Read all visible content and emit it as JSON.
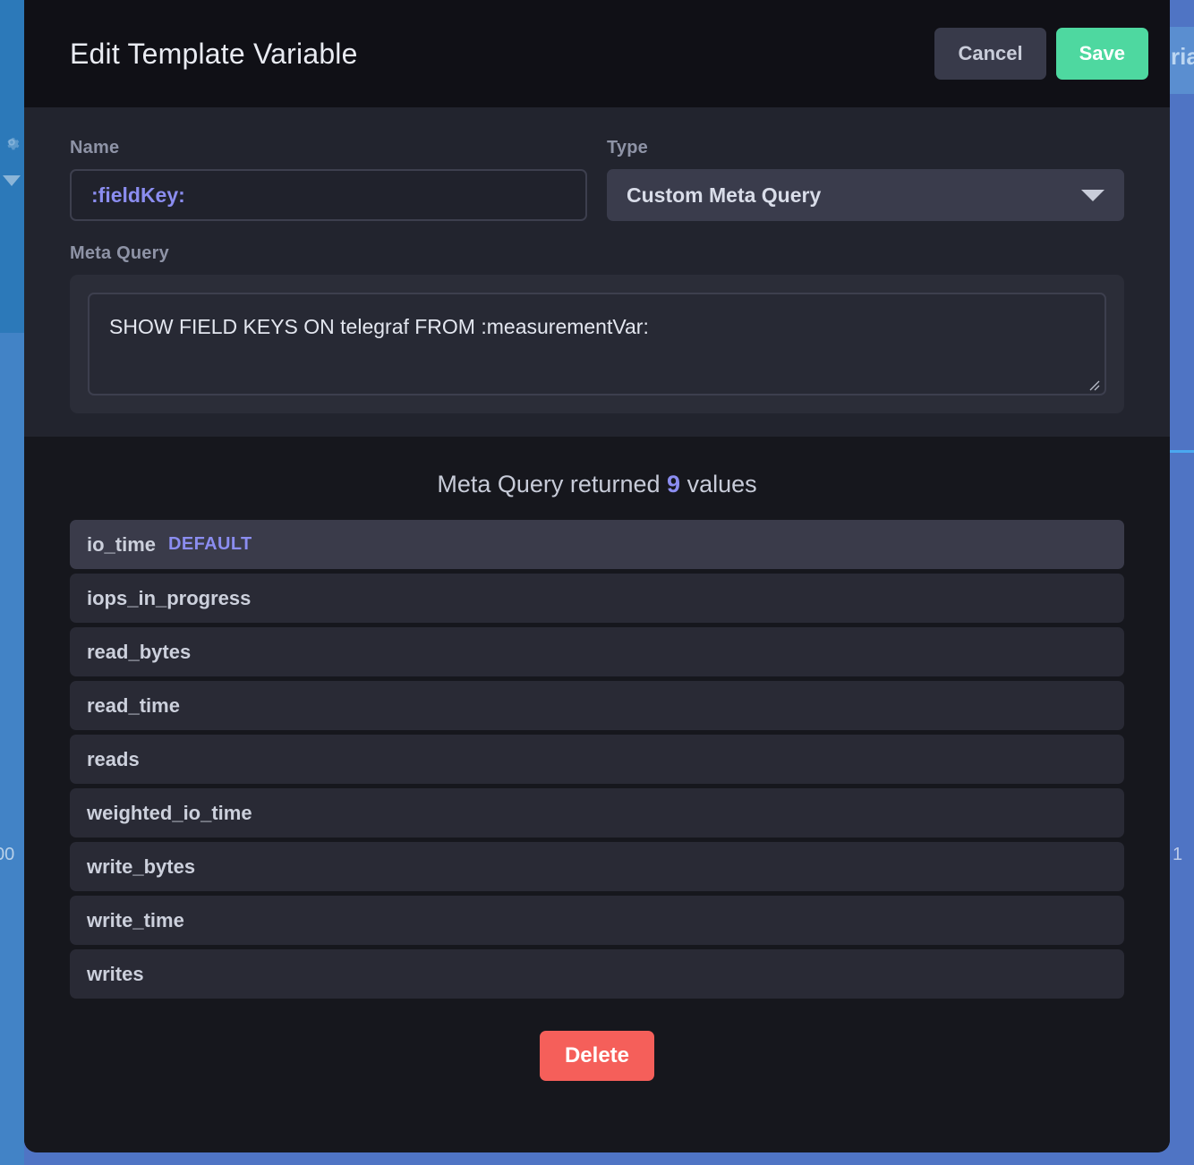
{
  "background": {
    "sidebar_gear_icon": "gear-icon",
    "sidebar_caret_icon": "caret-down-icon",
    "left_axis_label": "00",
    "right_panel_text": "ria",
    "right_axis_label": "1"
  },
  "header": {
    "title": "Edit Template Variable",
    "cancel_label": "Cancel",
    "save_label": "Save",
    "save_color": "#4ed8a0",
    "cancel_color": "#383a4a"
  },
  "form": {
    "name_label": "Name",
    "name_value": ":fieldKey:",
    "name_value_color": "#8b8df0",
    "type_label": "Type",
    "type_value": "Custom Meta Query",
    "type_caret_icon": "chevron-down-icon",
    "metaquery_label": "Meta Query",
    "metaquery_value": "SHOW FIELD KEYS ON telegraf FROM :measurementVar:",
    "resize_grip_icon": "resize-grip-icon"
  },
  "results": {
    "count_prefix": "Meta Query returned",
    "count": "9",
    "count_suffix": "values",
    "count_color": "#8b8df0",
    "default_badge_label": "DEFAULT",
    "values": [
      {
        "name": "io_time",
        "is_default": true
      },
      {
        "name": "iops_in_progress",
        "is_default": false
      },
      {
        "name": "read_bytes",
        "is_default": false
      },
      {
        "name": "read_time",
        "is_default": false
      },
      {
        "name": "reads",
        "is_default": false
      },
      {
        "name": "weighted_io_time",
        "is_default": false
      },
      {
        "name": "write_bytes",
        "is_default": false
      },
      {
        "name": "write_time",
        "is_default": false
      },
      {
        "name": "writes",
        "is_default": false
      }
    ]
  },
  "footer": {
    "delete_label": "Delete",
    "delete_color": "#f55f5a"
  }
}
